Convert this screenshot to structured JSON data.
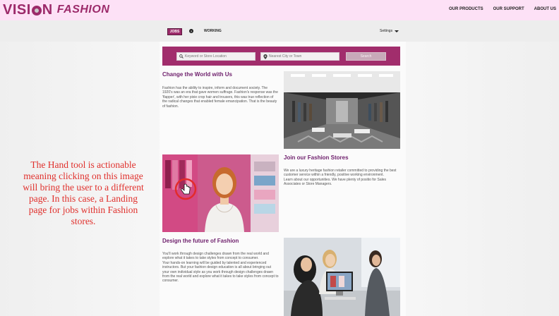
{
  "header": {
    "logo_text": "VISION FASHION",
    "nav": [
      "OUR PRODUCTS",
      "OUR SUPPORT",
      "ABOUT US"
    ]
  },
  "subnav": {
    "jobs_label": "JOBS",
    "working_label": "WORKING",
    "settings_label": "Settings"
  },
  "search": {
    "keyword_placeholder": "Keyword or Store Location",
    "location_placeholder": "Nearest City or Town",
    "button_label": "Search"
  },
  "sections": [
    {
      "title": "Change the World with Us",
      "body": "Fashion has the ability to inspire, inform and document society. The 1920's was an era that gave women suffrage. Fashion's response was the 'flapper', with her pixie crop hair and trousers, this was true reflection of the radical changes that enabled female emancipation. That is the beauty of fashion."
    },
    {
      "title": "Join our Fashion Stores",
      "body": "We are a luxury heritage fashion retailer committed to providing the best customer service within a friendly, positive working environment.\nLearn about our opportunities. We have plenty of positio for Sales Associates or Store Managers."
    },
    {
      "title": "Design the future of Fashion",
      "body": "You'll work through design challenges drawn from the real world and explore what it takes to take styles from concept to consumer.\nYour hands-on learning will be guided by talented and experienced instructors. But your fashion design education is all about bringing out your own individual style as you work through design challenges drawn from the real world and explore what it takes to take styles from concept to consumer."
    }
  ],
  "annotation": "The Hand tool is actionable meaning clicking on this image will bring the user to a different page. In this case, a Landing page for jobs within Fashion stores.",
  "colors": {
    "brand": "#9c2a6a",
    "topbar": "#fde1f6",
    "heading": "#6e1f6c",
    "annotation": "#e0302c"
  }
}
